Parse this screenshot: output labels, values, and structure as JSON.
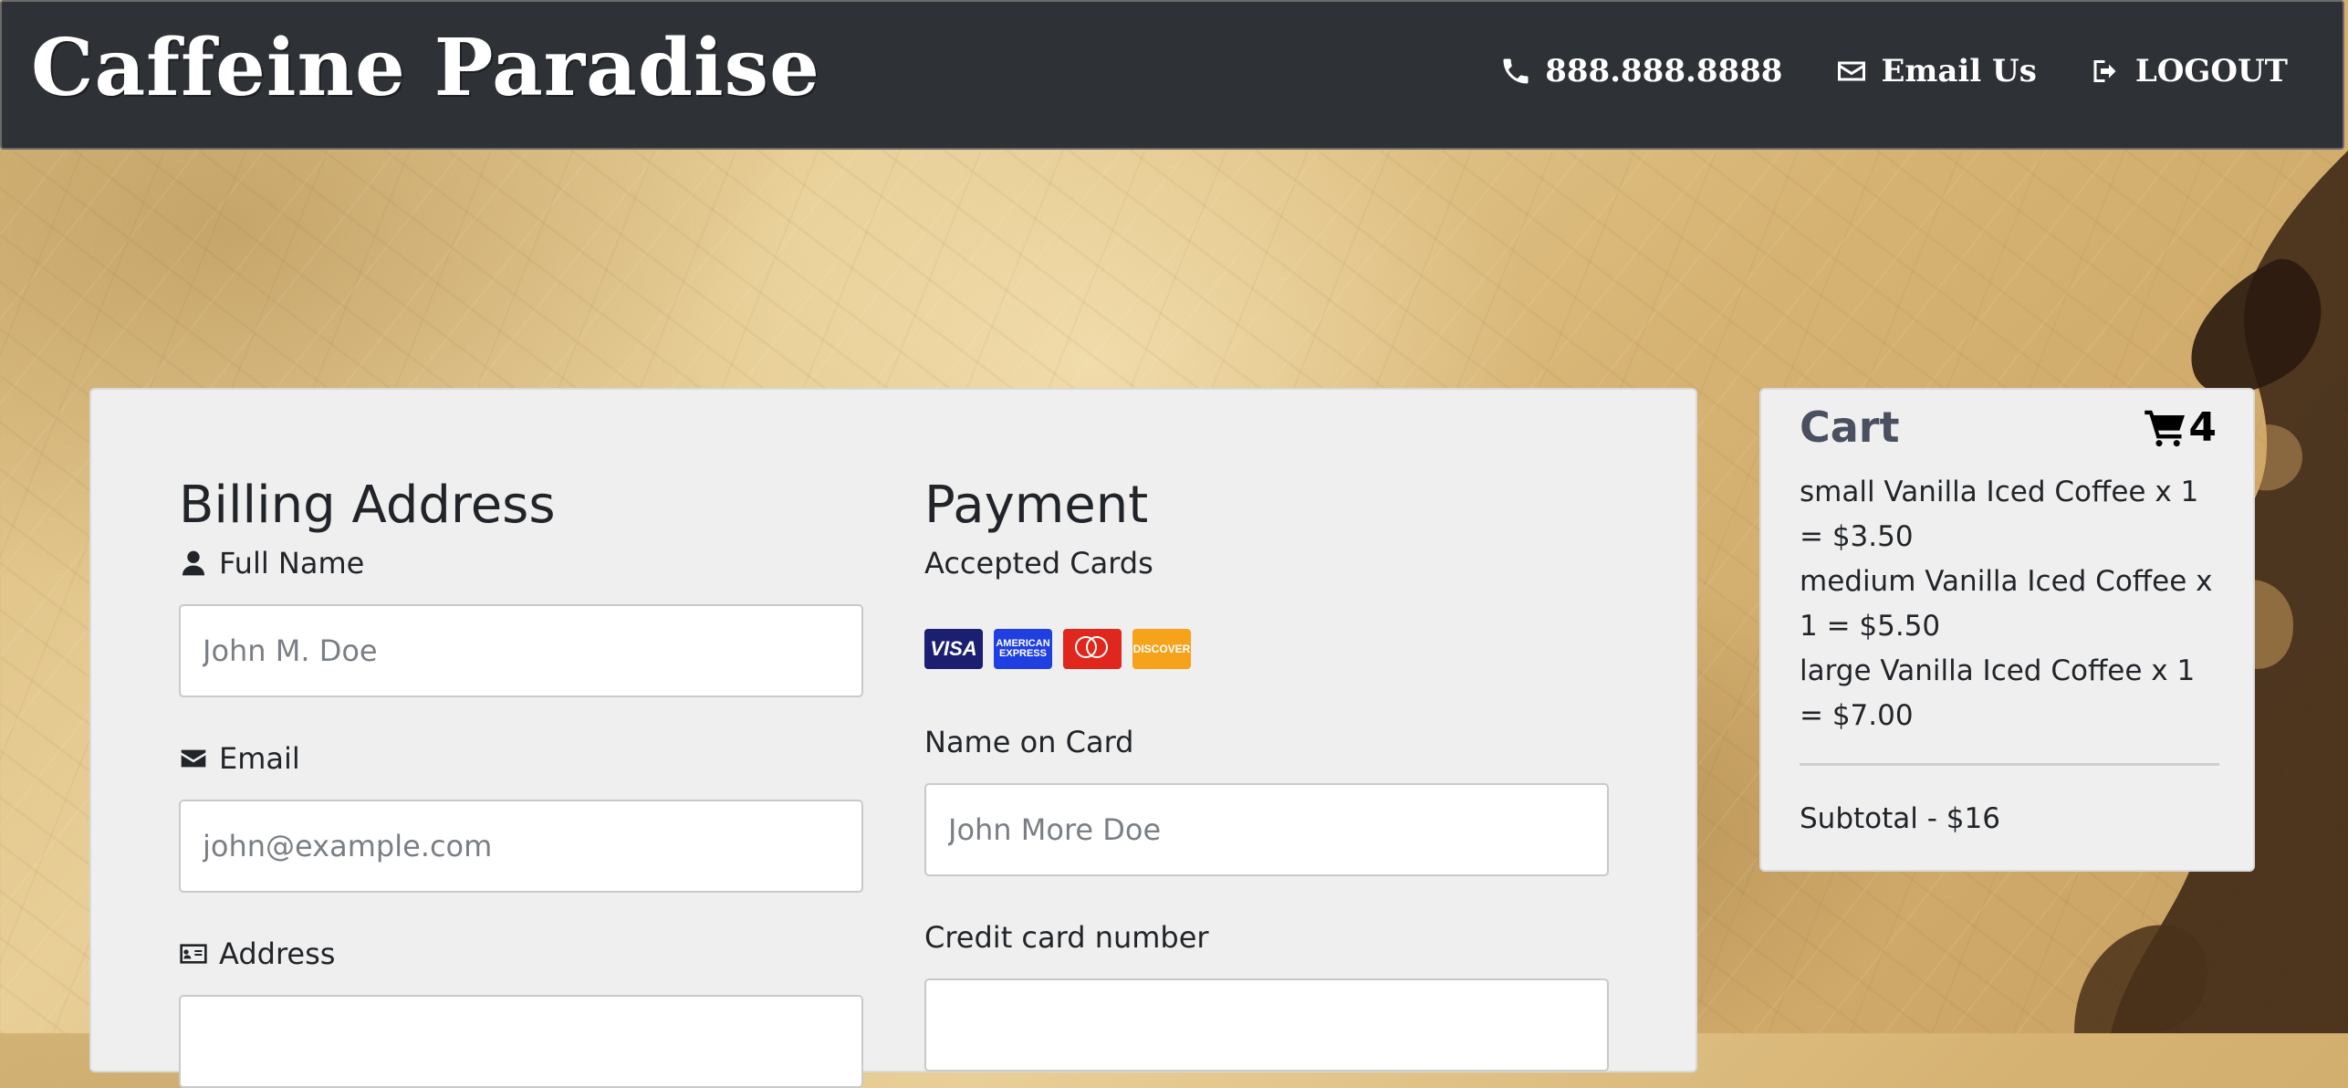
{
  "navbar": {
    "brand": "Caffeine Paradise",
    "phone": "888.888.8888",
    "email": "Email Us",
    "logout": "LOGOUT"
  },
  "billing": {
    "heading": "Billing Address",
    "full_name_label": "Full Name",
    "full_name_placeholder": "John M. Doe",
    "email_label": "Email",
    "email_placeholder": "john@example.com",
    "address_label": "Address"
  },
  "payment": {
    "heading": "Payment",
    "accepted_cards_label": "Accepted Cards",
    "cards": [
      "VISA",
      "AMERICAN EXPRESS",
      "mastercard",
      "DISCOVER"
    ],
    "name_on_card_label": "Name on Card",
    "name_on_card_placeholder": "John More Doe",
    "card_number_label": "Credit card number"
  },
  "cart": {
    "title": "Cart",
    "count": "4",
    "items": [
      "small Vanilla Iced Coffee x 1 = $3.50",
      "medium Vanilla Iced Coffee x 1 = $5.50",
      "large Vanilla Iced Coffee x 1 = $7.00"
    ],
    "subtotal": "Subtotal - $16"
  },
  "colors": {
    "navbar_bg": "#2e3136",
    "panel_bg": "#f0efef",
    "cart_title": "#4a5060"
  }
}
